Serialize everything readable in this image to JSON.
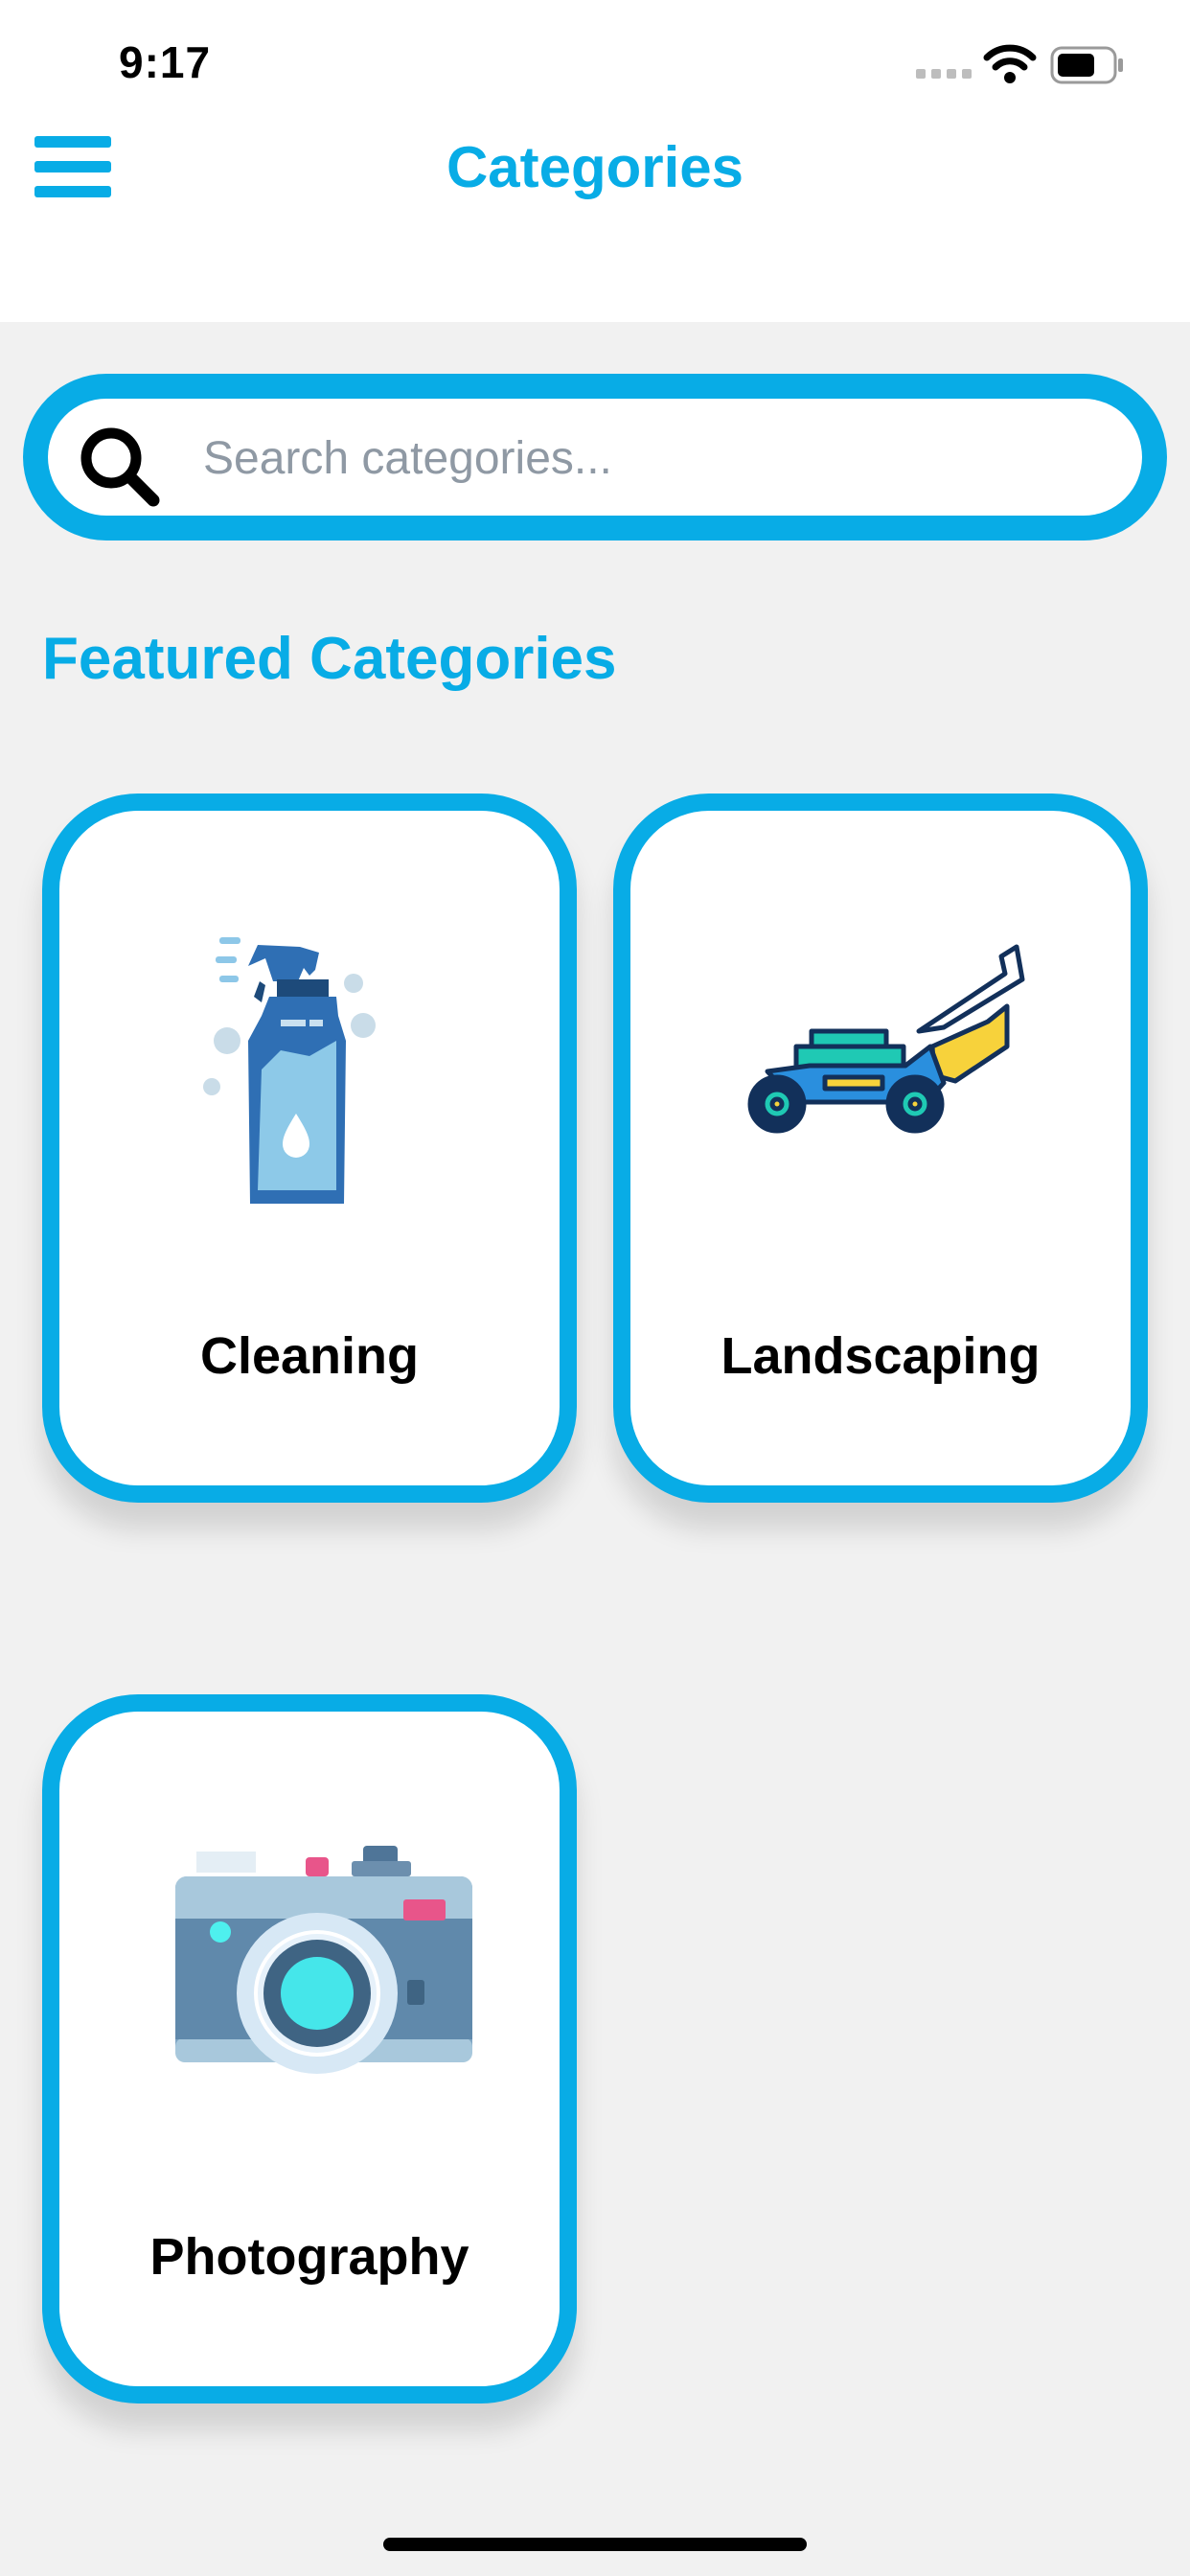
{
  "status_bar": {
    "time": "9:17"
  },
  "header": {
    "title": "Categories",
    "menu_icon": "hamburger-menu-icon"
  },
  "search": {
    "placeholder": "Search categories...",
    "value": "",
    "icon": "search-icon"
  },
  "featured": {
    "title": "Featured Categories",
    "categories": [
      {
        "label": "Cleaning",
        "icon": "spray-bottle-icon"
      },
      {
        "label": "Landscaping",
        "icon": "lawn-mower-icon"
      },
      {
        "label": "Photography",
        "icon": "camera-icon"
      }
    ]
  },
  "colors": {
    "accent": "#08ace6",
    "background": "#f1f1f1",
    "card": "#ffffff"
  }
}
